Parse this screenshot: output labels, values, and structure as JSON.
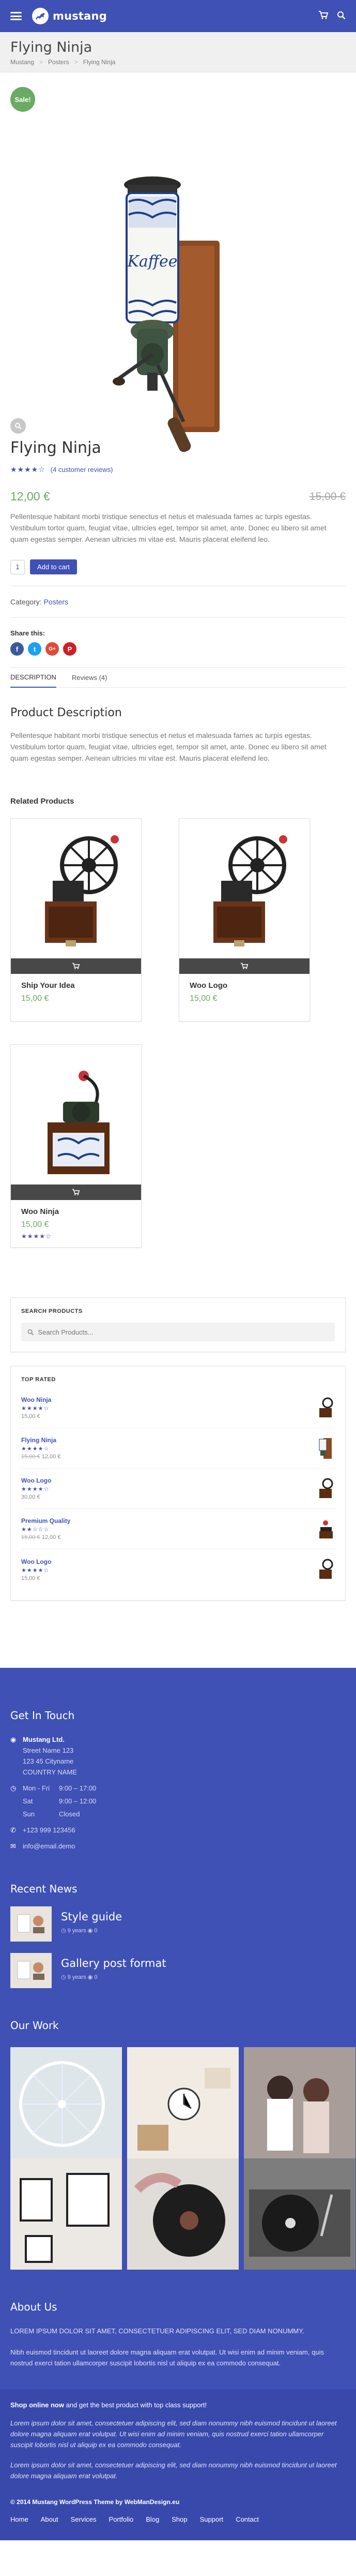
{
  "header": {
    "logo_text": "mustang"
  },
  "title_band": {
    "title": "Flying Ninja",
    "breadcrumb": [
      "Mustang",
      "Posters",
      "Flying Ninja"
    ]
  },
  "product": {
    "sale_badge": "Sale!",
    "image_text": "Kaffee",
    "title": "Flying Ninja",
    "rating": 4,
    "rating_display": "★★★★☆",
    "reviews": "(4 customer reviews)",
    "price": "12,00 €",
    "old_price": "15,00 €",
    "short_description": "Pellentesque habitant morbi tristique senectus et netus et malesuada fames ac turpis egestas. Vestibulum tortor quam, feugiat vitae, ultricies eget, tempor sit amet, ante. Donec eu libero sit amet quam egestas semper. Aenean ultricies mi vitae est. Mauris placerat eleifend leo.",
    "quantity": "1",
    "add_to_cart": "Add to cart",
    "category_label": "Category:",
    "category": "Posters",
    "share_label": "Share this:",
    "share_icons": [
      "f",
      "t",
      "G+",
      "P"
    ],
    "tabs": [
      "DESCRIPTION",
      "Reviews (4)"
    ],
    "description_title": "Product Description",
    "description": "Pellentesque habitant morbi tristique senectus et netus et malesuada fames ac turpis egestas. Vestibulum tortor quam, feugiat vitae, ultricies eget, tempor sit amet, ante. Donec eu libero sit amet quam egestas semper. Aenean ultricies mi vitae est. Mauris placerat eleifend leo."
  },
  "related": {
    "title": "Related Products",
    "items": [
      {
        "name": "Ship Your Idea",
        "price": "15,00 €",
        "stars": ""
      },
      {
        "name": "Woo Logo",
        "price": "15,00 €",
        "stars": ""
      },
      {
        "name": "Woo Ninja",
        "price": "15,00 €",
        "stars": "★★★★☆"
      }
    ]
  },
  "widgets": {
    "search_title": "SEARCH PRODUCTS",
    "search_placeholder": "Search Products...",
    "top_rated_title": "TOP RATED",
    "top_rated": [
      {
        "name": "Woo Ninja",
        "stars": "★★★★☆",
        "old": "",
        "price": "15,00 €"
      },
      {
        "name": "Flying Ninja",
        "stars": "★★★★☆",
        "old": "15,00 €",
        "price": "12,00 €"
      },
      {
        "name": "Woo Logo",
        "stars": "★★★★☆",
        "old": "",
        "price": "30,00 €"
      },
      {
        "name": "Premium Quality",
        "stars": "★★☆☆☆",
        "old": "15,00 €",
        "price": "12,00 €"
      },
      {
        "name": "Woo Logo",
        "stars": "★★★★☆",
        "old": "",
        "price": "15,00 €"
      }
    ]
  },
  "footer": {
    "contact_title": "Get In Touch",
    "company": "Mustang Ltd.",
    "address": [
      "Street Name 123",
      "123 45 Cityname",
      "COUNTRY NAME"
    ],
    "hours": [
      [
        "Mon - Fri",
        "9:00 – 17:00"
      ],
      [
        "Sat",
        "9:00 – 12:00"
      ],
      [
        "Sun",
        "Closed"
      ]
    ],
    "phone": "+123 999 123456",
    "email": "info@email.demo",
    "news_title": "Recent News",
    "news": [
      {
        "title": "Style guide",
        "meta": "◷ 9 years   ◉ 0"
      },
      {
        "title": "Gallery post format",
        "meta": "◷ 9 years   ◉ 0"
      }
    ],
    "work_title": "Our Work",
    "about_title": "About Us",
    "about_lead": "LOREM IPSUM DOLOR SIT AMET, CONSECTETUER ADIPISCING ELIT, SED DIAM NONUMMY.",
    "about_text": "Nibh euismod tincidunt ut laoreet dolore magna aliquam erat volutpat. Ut wisi enim ad minim veniam, quis nostrud exerci tation ullamcorper suscipit lobortis nisl ut aliquip ex ea commodo consequat.",
    "promo_head": "Shop online now",
    "promo_rest": " and get the best product with top class support!",
    "promo_text_1": "Lorem ipsum dolor sit amet, consectetuer adipiscing elit, sed diam nonummy nibh euismod tincidunt ut laoreet dolore magna aliquam erat volutpat. Ut wisi enim ad minim veniam, quis nostrud exerci tation ullamcorper suscipit lobortis nisl ut aliquip ex ea commodo consequat.",
    "promo_text_2": "Lorem ipsum dolor sit amet, consectetuer adipiscing elit, sed diam nonummy nibh euismod tincidunt ut laoreet dolore magna aliquam erat volutpat.",
    "copyright": "© 2014 Mustang WordPress Theme by WebManDesign.eu",
    "nav": [
      "Home",
      "About",
      "Services",
      "Portfolio",
      "Blog",
      "Shop",
      "Support",
      "Contact"
    ]
  },
  "colors": {
    "brand": "#3f51b5",
    "price_green": "#6aaa64"
  }
}
